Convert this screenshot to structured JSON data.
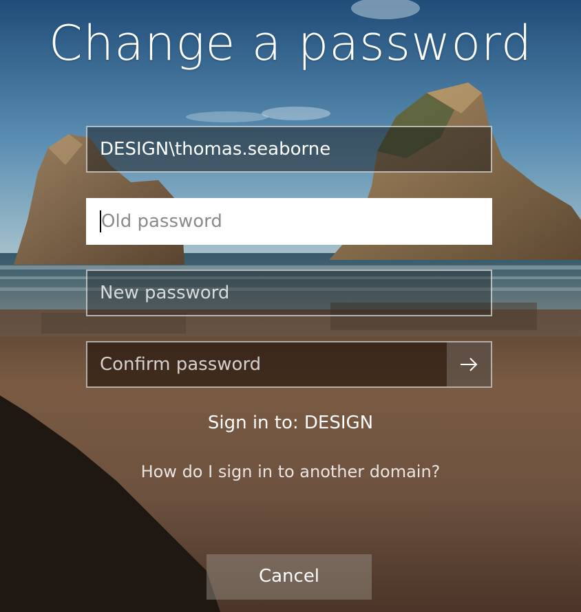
{
  "title": "Change a password",
  "fields": {
    "username_value": "DESIGN\\thomas.seaborne",
    "old_password_placeholder": "Old password",
    "new_password_placeholder": "New password",
    "confirm_password_placeholder": "Confirm password"
  },
  "sign_in_to": "Sign in to: DESIGN",
  "other_domain_link": "How do I sign in to another domain?",
  "cancel_label": "Cancel",
  "icons": {
    "submit": "arrow-right-icon"
  },
  "colors": {
    "text": "#ffffff",
    "focused_field_bg": "#ffffff",
    "placeholder_on_focus": "#8a8a8a"
  }
}
